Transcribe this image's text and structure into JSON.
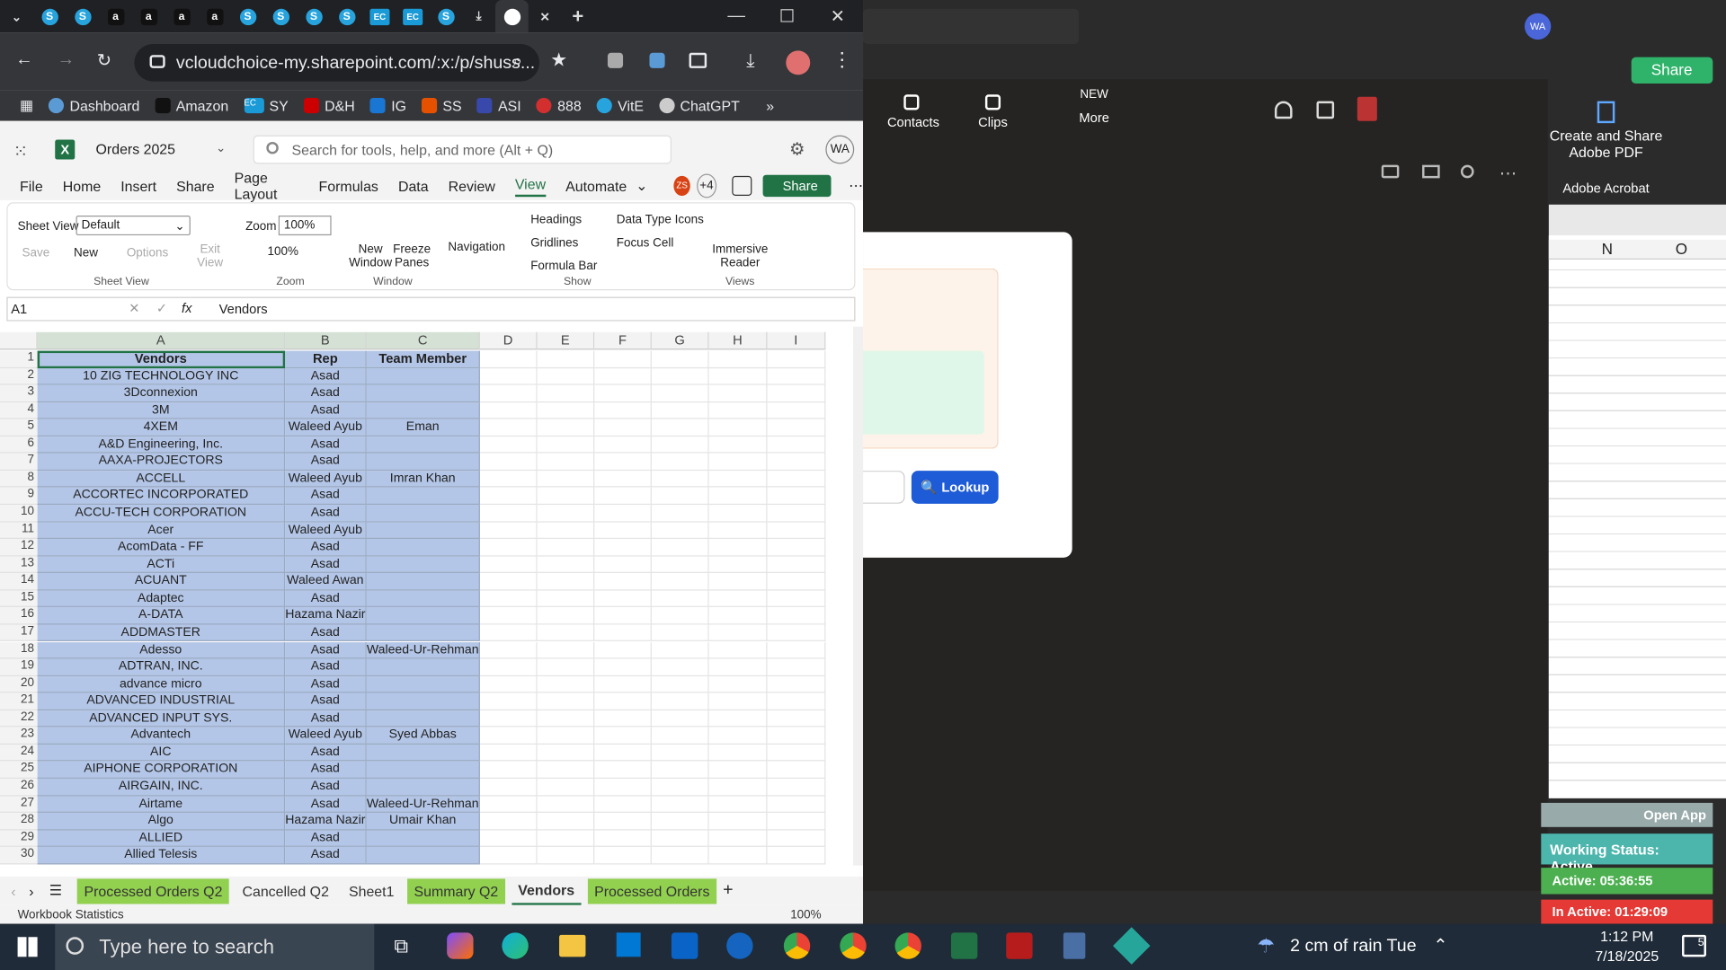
{
  "browser": {
    "url": "vcloudchoice-my.sharepoint.com/:x:/p/shuss...",
    "tabs": [
      "S",
      "S",
      "a",
      "a",
      "a",
      "a",
      "S",
      "S",
      "S",
      "S",
      "EC",
      "EC",
      "S"
    ],
    "bookmarks": [
      "Dashboard",
      "Amazon",
      "SY",
      "D&H",
      "IG",
      "SS",
      "ASI",
      "888",
      "VitE",
      "ChatGPT"
    ],
    "ec_label": "EC",
    "more": "»"
  },
  "excel": {
    "title": "Orders 2025",
    "search_placeholder": "Search for tools, help, and more (Alt + Q)",
    "avatar": "WA",
    "menu": [
      "File",
      "Home",
      "Insert",
      "Share",
      "Page Layout",
      "Formulas",
      "Data",
      "Review",
      "View",
      "Automate"
    ],
    "active_menu": "View",
    "collab_badge": "ZS",
    "collab_more": "+4",
    "share": "Share",
    "ribbon": {
      "sheet_view_label": "Sheet View",
      "sheet_view_value": "Default",
      "save": "Save",
      "new": "New",
      "options": "Options",
      "exit_view": "Exit\nView",
      "group_sheet_view": "Sheet View",
      "zoom_label": "Zoom",
      "zoom_value": "100%",
      "zoom_100": "100%",
      "group_zoom": "Zoom",
      "new_window": "New\nWindow",
      "freeze_panes": "Freeze\nPanes",
      "group_window": "Window",
      "navigation": "Navigation",
      "headings": "Headings",
      "gridlines": "Gridlines",
      "formula_bar": "Formula Bar",
      "data_type_icons": "Data Type Icons",
      "focus_cell": "Focus Cell",
      "group_show": "Show",
      "immersive_reader": "Immersive\nReader",
      "group_views": "Views"
    },
    "name_box": "A1",
    "formula": "Vendors",
    "columns": [
      "A",
      "B",
      "C",
      "D",
      "E",
      "F",
      "G",
      "H",
      "I"
    ],
    "header_row": [
      "Vendors",
      "Rep",
      "Team Member"
    ],
    "rows": [
      [
        "10 ZIG TECHNOLOGY INC",
        "Asad",
        ""
      ],
      [
        "3Dconnexion",
        "Asad",
        ""
      ],
      [
        "3M",
        "Asad",
        ""
      ],
      [
        "4XEM",
        "Waleed Ayub",
        "Eman"
      ],
      [
        "A&D Engineering, Inc.",
        "Asad",
        ""
      ],
      [
        "AAXA-PROJECTORS",
        "Asad",
        ""
      ],
      [
        "ACCELL",
        "Waleed Ayub",
        "Imran Khan"
      ],
      [
        "ACCORTEC INCORPORATED",
        "Asad",
        ""
      ],
      [
        "ACCU-TECH CORPORATION",
        "Asad",
        ""
      ],
      [
        "Acer",
        "Waleed Ayub",
        ""
      ],
      [
        "AcomData - FF",
        "Asad",
        ""
      ],
      [
        "ACTi",
        "Asad",
        ""
      ],
      [
        "ACUANT",
        "Waleed Awan",
        ""
      ],
      [
        "Adaptec",
        "Asad",
        ""
      ],
      [
        "A-DATA",
        "Hazama Nazir",
        ""
      ],
      [
        "ADDMASTER",
        "Asad",
        ""
      ],
      [
        "Adesso",
        "Asad",
        "Waleed-Ur-Rehman"
      ],
      [
        "ADTRAN, INC.",
        "Asad",
        ""
      ],
      [
        "advance micro",
        "Asad",
        ""
      ],
      [
        "ADVANCED INDUSTRIAL",
        "Asad",
        ""
      ],
      [
        "ADVANCED INPUT SYS.",
        "Asad",
        ""
      ],
      [
        "Advantech",
        "Waleed Ayub",
        "Syed Abbas"
      ],
      [
        "AIC",
        "Asad",
        ""
      ],
      [
        "AIPHONE CORPORATION",
        "Asad",
        ""
      ],
      [
        "AIRGAIN, INC.",
        "Asad",
        ""
      ],
      [
        "Airtame",
        "Asad",
        "Waleed-Ur-Rehman"
      ],
      [
        "Algo",
        "Hazama Nazir",
        "Umair Khan"
      ],
      [
        "ALLIED",
        "Asad",
        ""
      ],
      [
        "Allied Telesis",
        "Asad",
        ""
      ]
    ],
    "row_numbers": [
      "1",
      "2",
      "3",
      "4",
      "5",
      "6",
      "7",
      "8",
      "9",
      "10",
      "11",
      "12",
      "13",
      "14",
      "15",
      "16",
      "17",
      "18",
      "19",
      "20",
      "21",
      "22",
      "23",
      "24",
      "25",
      "26",
      "27",
      "28",
      "29",
      "30"
    ],
    "sheets": [
      "Processed Orders Q2",
      "Cancelled Q2",
      "Sheet1",
      "Summary Q2",
      "Vendors",
      "Processed Orders"
    ],
    "active_sheet": "Vendors",
    "status_left": "Workbook Statistics",
    "status_zoom": "100%"
  },
  "teams": {
    "contacts": "Contacts",
    "clips": "Clips",
    "more": "More",
    "new_badge": "NEW",
    "lookup": "Lookup",
    "share": "Share",
    "avatar": "WA"
  },
  "acrobat": {
    "create": "Create and Share\nAdobe PDF",
    "name": "Adobe Acrobat"
  },
  "xl2": {
    "cols": [
      "N",
      "O"
    ]
  },
  "widget": {
    "open_app": "Open App",
    "working": "Working Status: Active",
    "active": "Active: 05:36:55",
    "inactive": "In Active: 01:29:09",
    "pct": "100%"
  },
  "taskbar": {
    "search": "Type here to search",
    "weather": "2 cm of rain  Tue",
    "time": "1:12 PM",
    "date": "7/18/2025",
    "notif": "5"
  }
}
